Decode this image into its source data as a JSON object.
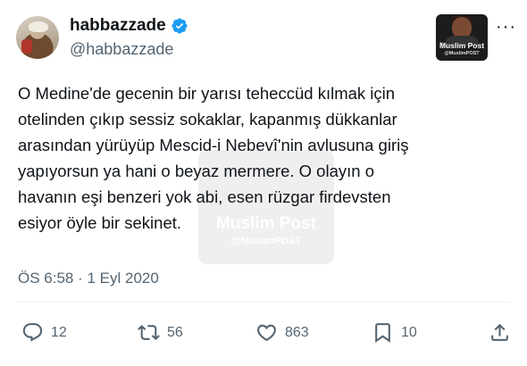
{
  "author": {
    "name": "habbazzade",
    "handle": "@habbazzade",
    "verified": true,
    "verified_color": "#1d9bf0"
  },
  "publisher_logo": {
    "title": "Muslim Post",
    "subtitle": "@MuslimPOST"
  },
  "watermark": {
    "title": "Muslim Post",
    "subtitle": "@MuslimPOST"
  },
  "tweet": {
    "text": "O Medine'de gecenin bir yarısı teheccüd kılmak için\notelinden çıkıp sessiz sokaklar, kapanmış dükkanlar\narasından yürüyüp Mescid-i Nebevî'nin avlusuna giriş\nyapıyorsun ya hani o beyaz mermere. O olayın o\nhavanın eşi benzeri yok abi, esen rüzgar firdevsten\nesiyor öyle bir sekinet.",
    "timestamp": "ÖS 6:58 · 1 Eyl 2020"
  },
  "actions": {
    "replies": "12",
    "reposts": "56",
    "likes": "863",
    "bookmarks": "10"
  },
  "icons": [
    "more-icon",
    "reply-icon",
    "repost-icon",
    "like-icon",
    "bookmark-icon",
    "share-icon",
    "verified-badge-icon"
  ]
}
